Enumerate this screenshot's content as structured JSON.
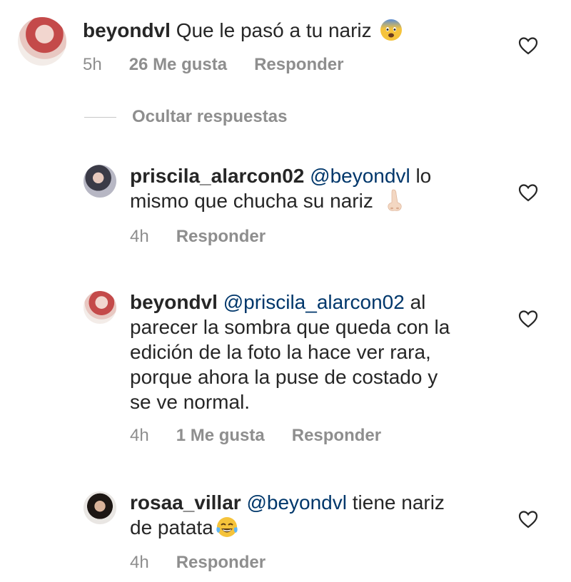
{
  "comment": {
    "username": "beyondvl",
    "text": "Que le pasó a tu nariz",
    "emoji": "fearful-face",
    "time": "5h",
    "likes": "26 Me gusta",
    "reply": "Responder"
  },
  "hide_replies": "Ocultar respuestas",
  "replies": [
    {
      "username": "priscila_alarcon02",
      "mention": "@beyondvl",
      "line1_rest": " lo",
      "line2": "mismo que chucha su nariz",
      "emoji": "nose",
      "time": "4h",
      "reply": "Responder"
    },
    {
      "username": "beyondvl",
      "mention": "@priscila_alarcon02",
      "line1_rest": " al",
      "lines": [
        "parecer la sombra que queda con la",
        "edición de la foto la hace ver rara,",
        "porque ahora la puse de costado y",
        "se ve normal."
      ],
      "time": "4h",
      "likes": "1 Me gusta",
      "reply": "Responder"
    },
    {
      "username": "rosaa_villar",
      "mention": "@beyondvl",
      "line1_rest": " tiene nariz",
      "line2": "de patata",
      "emoji": "tears-of-joy",
      "time": "4h",
      "reply": "Responder"
    }
  ],
  "colors": {
    "text": "#262626",
    "secondary": "#8e8e8e",
    "mention": "#00376b",
    "divider": "#c7c7c7"
  }
}
